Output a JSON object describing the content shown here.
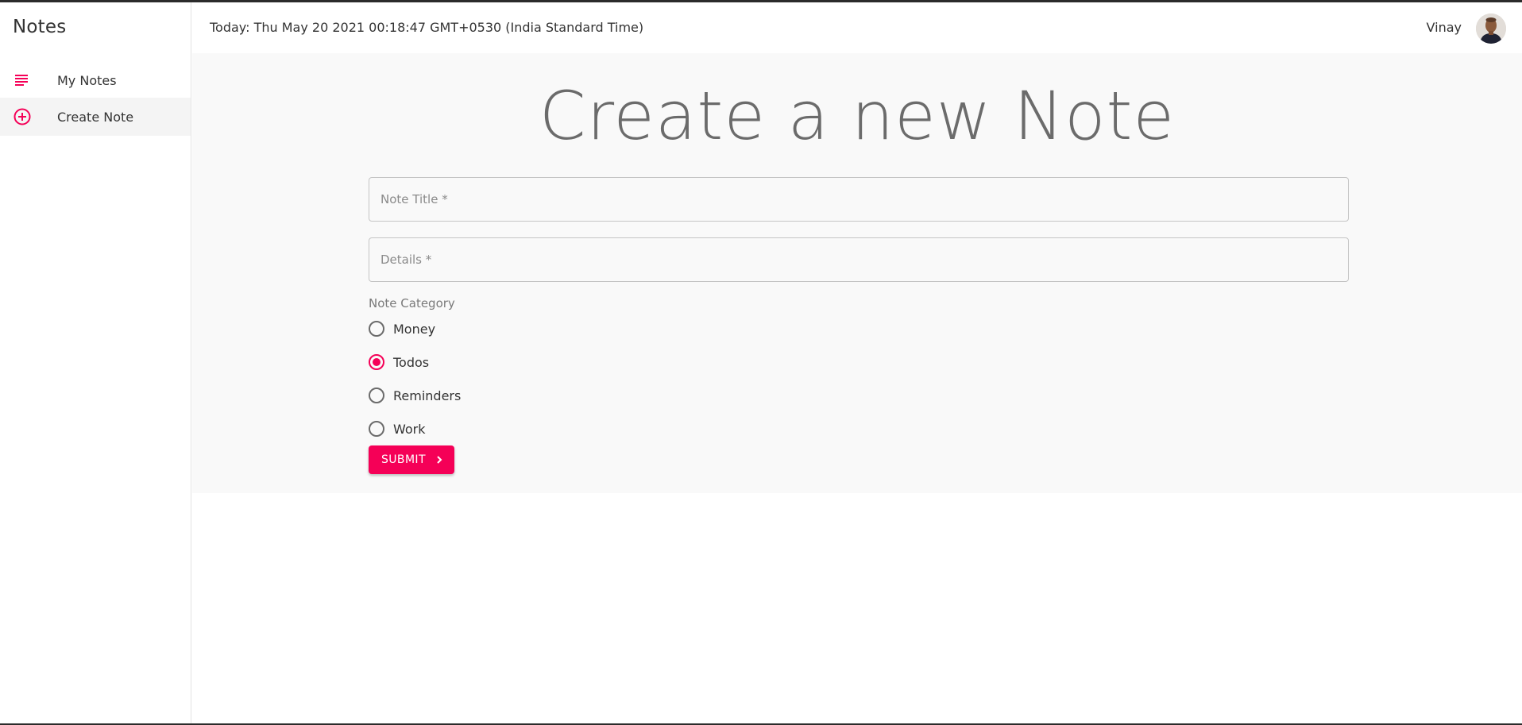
{
  "sidebar": {
    "brand": "Notes",
    "items": [
      {
        "label": "My Notes",
        "icon": "subject-icon"
      },
      {
        "label": "Create Note",
        "icon": "add-circle-outline-icon"
      }
    ]
  },
  "header": {
    "date_text": "Today: Thu May 20 2021 00:18:47 GMT+0530 (India Standard Time)",
    "user_name": "Vinay"
  },
  "main": {
    "title": "Create a new Note",
    "fields": {
      "title_placeholder": "Note Title *",
      "details_placeholder": "Details *"
    },
    "category": {
      "label": "Note Category",
      "options": [
        "Money",
        "Todos",
        "Reminders",
        "Work"
      ],
      "selected": "Todos"
    },
    "submit_label": "SUBMIT"
  },
  "colors": {
    "accent": "#f50057",
    "panel_bg": "#f9f9f9",
    "active_item_bg": "#f4f4f4"
  }
}
